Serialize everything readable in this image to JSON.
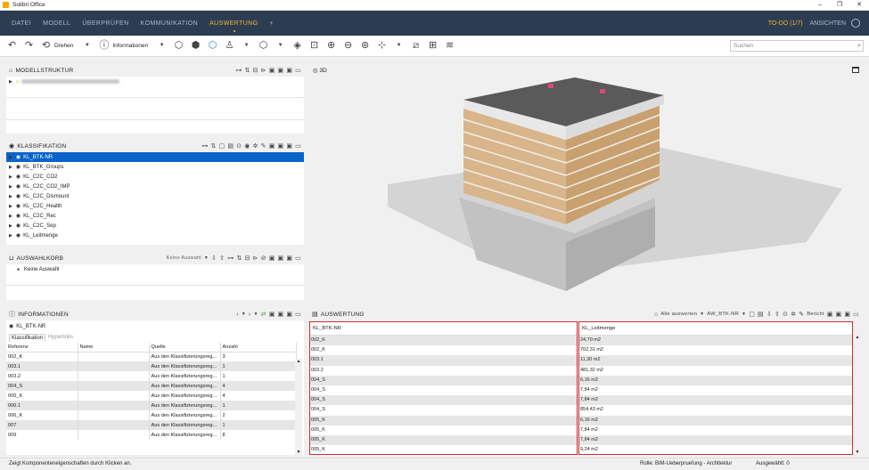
{
  "app": {
    "title": "Solibri Office",
    "win_min": "–",
    "win_max": "❐",
    "win_close": "✕"
  },
  "menu": {
    "items": [
      "DATEI",
      "MODELL",
      "ÜBERPRÜFEN",
      "KOMMUNIKATION",
      "AUSWERTUNG",
      "+"
    ],
    "active": "AUSWERTUNG",
    "todo": "TO-DO (1/7)",
    "ansichten": "ANSICHTEN"
  },
  "toolbar": {
    "drehen": "Drehen",
    "informationen": "Informationen",
    "search_placeholder": "Suchen"
  },
  "modellstruktur": {
    "title": "MODELLSTRUKTUR"
  },
  "klassifikation": {
    "title": "KLASSIFIKATION",
    "items": [
      "KL_BTK-NR",
      "KL_BTK_Groups",
      "KL_C2C_CO2",
      "KL_C2C_CO2_IMP",
      "KL_C2C_Dismount",
      "KL_C2C_Health",
      "KL_C2C_Rec",
      "KL_C2C_Sep",
      "KL_Leitmenge"
    ],
    "selected": "KL_BTK-NR"
  },
  "auswahlkorb": {
    "title": "AUSWAHLKORB",
    "dropdown": "Keine Auswahl",
    "item": "Keine Auswahl"
  },
  "view3d": {
    "label": "3D"
  },
  "informationen": {
    "title": "INFORMATIONEN",
    "object": "KL_BTK-NR",
    "tabs": [
      "Klassifikation",
      "Hyperlinks"
    ],
    "columns": [
      "Referenz",
      "Name",
      "Quelle",
      "Anzahl"
    ],
    "rows": [
      [
        "002_K",
        "",
        "Aus den Klassifizierungsreg...",
        "3"
      ],
      [
        "003.1",
        "",
        "Aus den Klassifizierungsreg...",
        "1"
      ],
      [
        "003.2",
        "",
        "Aus den Klassifizierungsreg...",
        "1"
      ],
      [
        "004_S",
        "",
        "Aus den Klassifizierungsreg...",
        "4"
      ],
      [
        "005_K",
        "",
        "Aus den Klassifizierungsreg...",
        "4"
      ],
      [
        "006.1",
        "",
        "Aus den Klassifizierungsreg...",
        "1"
      ],
      [
        "006_K",
        "",
        "Aus den Klassifizierungsreg...",
        "2"
      ],
      [
        "007",
        "",
        "Aus den Klassifizierungsreg...",
        "1"
      ],
      [
        "009",
        "",
        "Aus den Klassifizierungsreg...",
        "8"
      ]
    ]
  },
  "auswertung": {
    "title": "AUSWERTUNG",
    "alle": "Alle auswerten",
    "dropdown": "AW_BTK-NR",
    "bericht": "Bericht",
    "col1_header": "KL_BTK-NR",
    "col2_header": "KL_Leitmenge",
    "col1": [
      "002_K",
      "002_K",
      "003.1",
      "003.2",
      "004_S",
      "004_S",
      "004_S",
      "004_S",
      "005_K",
      "005_K",
      "005_K",
      "005_K"
    ],
    "col2": [
      "24,70 m2",
      "702,31 m2",
      "11,30 m2",
      "481,32 m2",
      "6,16 m2",
      "7,84 m2",
      "7,84 m2",
      "854,43 m2",
      "6,16 m2",
      "7,84 m2",
      "7,84 m2",
      "9,24 m2"
    ]
  },
  "status": {
    "left": "Zeigt Komponenteneigenschaften durch Klicken an.",
    "role": "Rolle: BIM-Ueberpruefung - Architektur",
    "selected": "Ausgewählt: 0"
  }
}
